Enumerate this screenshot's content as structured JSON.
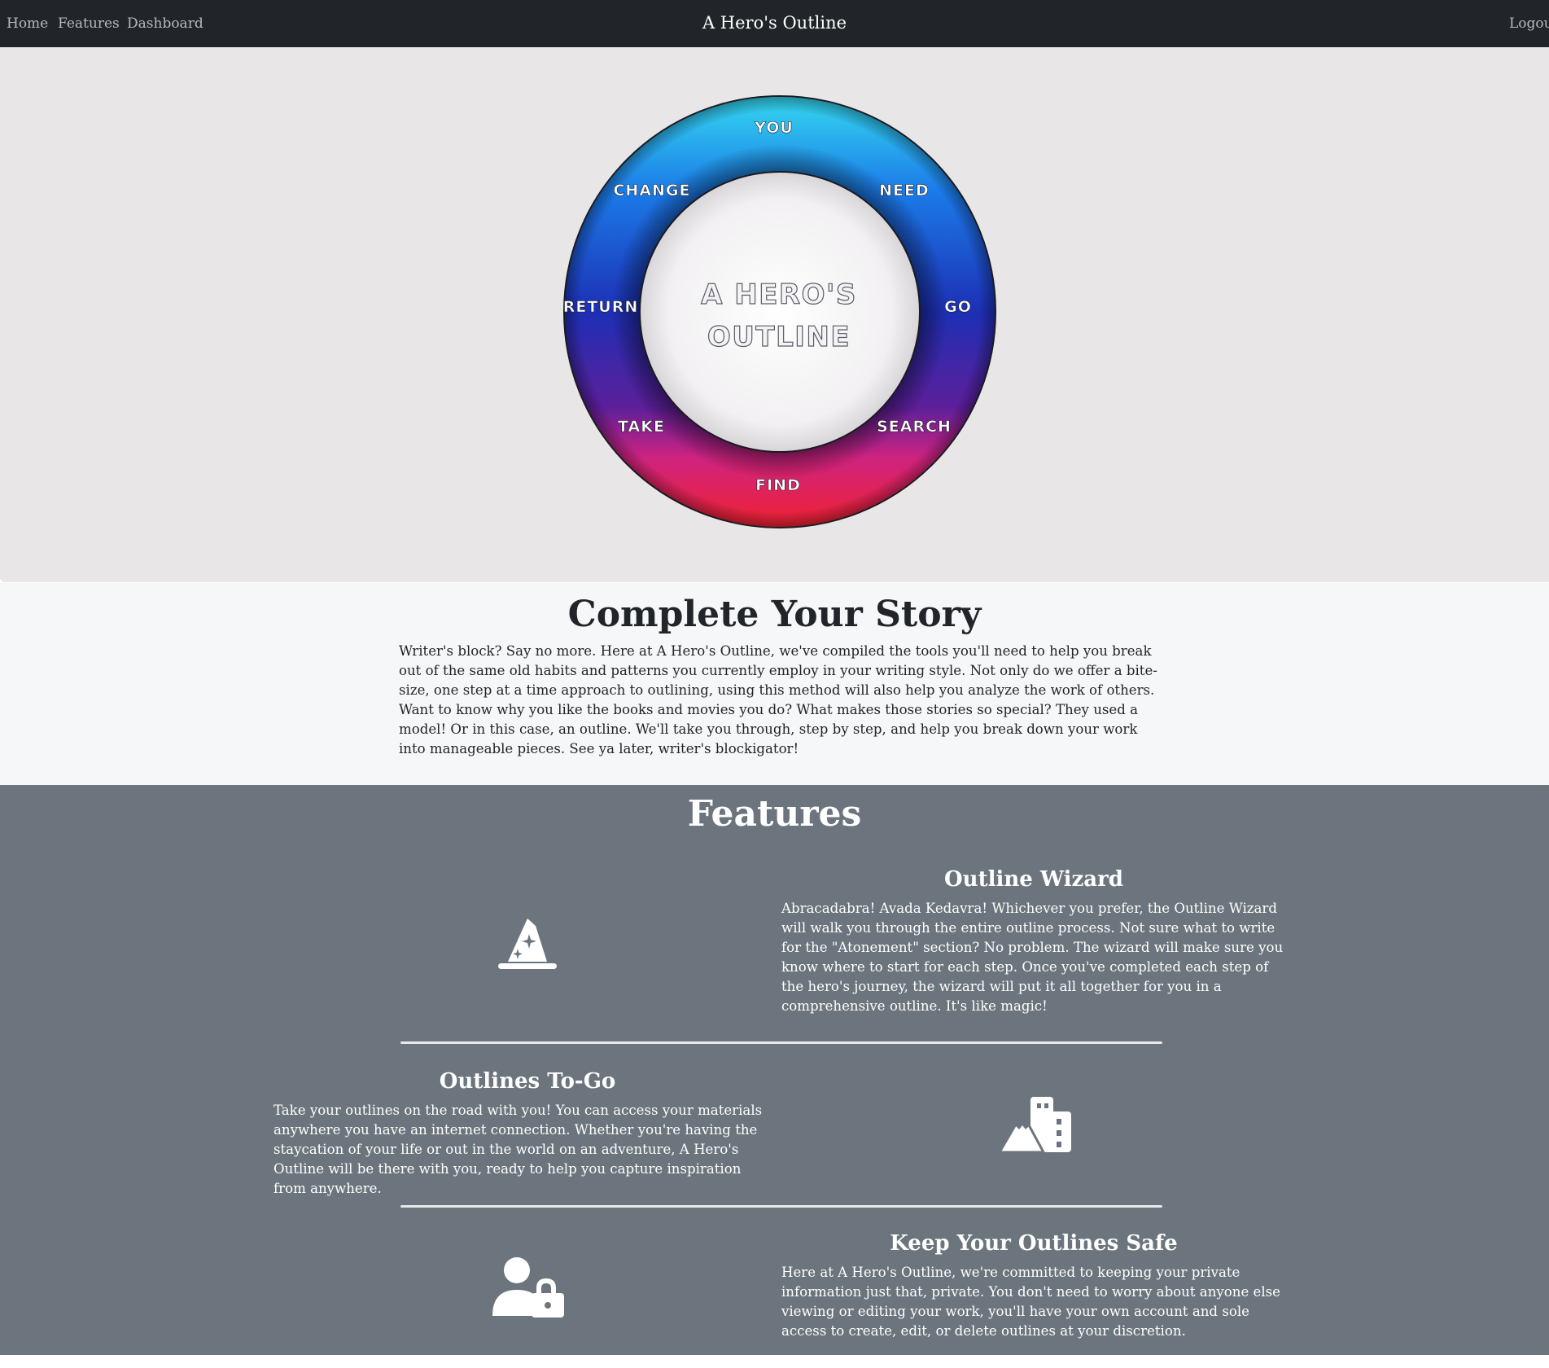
{
  "nav": {
    "links": [
      "Home",
      "Features",
      "Dashboard"
    ],
    "brand": "A Hero's Outline",
    "logout": "Logou"
  },
  "hero": {
    "wheel_title_line1": "A HERO'S",
    "wheel_title_line2": "OUTLINE",
    "steps": [
      "YOU",
      "NEED",
      "GO",
      "SEARCH",
      "FIND",
      "TAKE",
      "RETURN",
      "CHANGE"
    ]
  },
  "story": {
    "title": "Complete Your Story",
    "text": "Writer's block? Say no more. Here at A Hero's Outline, we've compiled the tools you'll need to help you break out of the same old habits and patterns you currently employ in your writing style. Not only do we offer a bite-size, one step at a time approach to outlining, using this method will also help you analyze the work of others. Want to know why you like the books and movies you do? What makes those stories so special? They used a model! Or in this case, an outline. We'll take you through, step by step, and help you break down your work into manageable pieces. See ya later, writer's blockigator!"
  },
  "features": {
    "title": "Features",
    "items": [
      {
        "heading": "Outline Wizard",
        "text": "Abracadabra! Avada Kedavra! Whichever you prefer, the Outline Wizard will walk you through the entire outline process. Not sure what to write for the \"Atonement\" section? No problem. The wizard will make sure you know where to start for each step. Once you've completed each step of the hero's journey, the wizard will put it all together for you in a comprehensive outline. It's like magic!",
        "icon": "wizard-hat-icon"
      },
      {
        "heading": "Outlines To-Go",
        "text": "Take your outlines on the road with you! You can access your materials anywhere you have an internet connection. Whether you're having the staycation of your life or out in the world on an adventure, A Hero's Outline will be there with you, ready to help you capture inspiration from anywhere.",
        "icon": "mountain-city-icon"
      },
      {
        "heading": "Keep Your Outlines Safe",
        "text": "Here at A Hero's Outline, we're committed to keeping your private information just that, private. You don't need to worry about anyone else viewing or editing your work, you'll have your own account and sole access to create, edit, or delete outlines at your discretion.",
        "icon": "user-lock-icon"
      }
    ]
  }
}
